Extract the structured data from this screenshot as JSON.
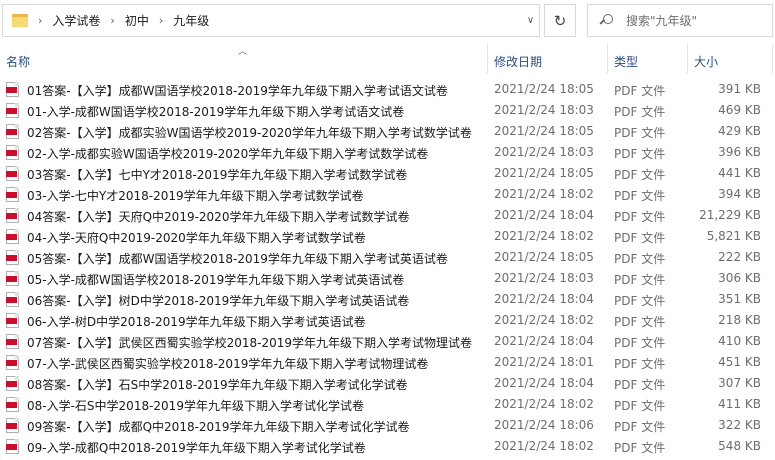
{
  "address_bar": {
    "breadcrumbs": [
      "入学试卷",
      "初中",
      "九年级"
    ],
    "refresh_icon": "refresh-icon"
  },
  "search": {
    "placeholder": "搜索\"九年级\""
  },
  "columns": {
    "name": "名称",
    "date": "修改日期",
    "type": "类型",
    "size": "大小"
  },
  "files": [
    {
      "name": "01答案-【入学】成都W国语学校2018-2019学年九年级下期入学考试语文试卷",
      "date": "2021/2/24 18:05",
      "type": "PDF 文件",
      "size": "391 KB"
    },
    {
      "name": "01-入学-成都W国语学校2018-2019学年九年级下期入学考试语文试卷",
      "date": "2021/2/24 18:03",
      "type": "PDF 文件",
      "size": "469 KB"
    },
    {
      "name": "02答案-【入学】成都实验W国语学校2019-2020学年九年级下期入学考试数学试卷",
      "date": "2021/2/24 18:05",
      "type": "PDF 文件",
      "size": "429 KB"
    },
    {
      "name": "02-入学-成都实验W国语学校2019-2020学年九年级下期入学考试数学试卷",
      "date": "2021/2/24 18:03",
      "type": "PDF 文件",
      "size": "396 KB"
    },
    {
      "name": "03答案-【入学】七中Y才2018-2019学年九年级下期入学考试数学试卷",
      "date": "2021/2/24 18:05",
      "type": "PDF 文件",
      "size": "441 KB"
    },
    {
      "name": "03-入学-七中Y才2018-2019学年九年级下期入学考试数学试卷",
      "date": "2021/2/24 18:02",
      "type": "PDF 文件",
      "size": "394 KB"
    },
    {
      "name": "04答案-【入学】天府Q中2019-2020学年九年级下期入学考试数学试卷",
      "date": "2021/2/24 18:04",
      "type": "PDF 文件",
      "size": "21,229 KB"
    },
    {
      "name": "04-入学-天府Q中2019-2020学年九年级下期入学考试数学试卷",
      "date": "2021/2/24 18:02",
      "type": "PDF 文件",
      "size": "5,821 KB"
    },
    {
      "name": "05答案-【入学】成都W国语学校2018-2019学年九年级下期入学考试英语试卷",
      "date": "2021/2/24 18:05",
      "type": "PDF 文件",
      "size": "222 KB"
    },
    {
      "name": "05-入学-成都W国语学校2018-2019学年九年级下期入学考试英语试卷",
      "date": "2021/2/24 18:03",
      "type": "PDF 文件",
      "size": "306 KB"
    },
    {
      "name": "06答案-【入学】树D中学2018-2019学年九年级下期入学考试英语试卷",
      "date": "2021/2/24 18:04",
      "type": "PDF 文件",
      "size": "351 KB"
    },
    {
      "name": "06-入学-树D中学2018-2019学年九年级下期入学考试英语试卷",
      "date": "2021/2/24 18:02",
      "type": "PDF 文件",
      "size": "218 KB"
    },
    {
      "name": "07答案-【入学】武侯区西蜀实验学校2018-2019学年九年级下期入学考试物理试卷",
      "date": "2021/2/24 18:04",
      "type": "PDF 文件",
      "size": "410 KB"
    },
    {
      "name": "07-入学-武侯区西蜀实验学校2018-2019学年九年级下期入学考试物理试卷",
      "date": "2021/2/24 18:01",
      "type": "PDF 文件",
      "size": "451 KB"
    },
    {
      "name": "08答案-【入学】石S中学2018-2019学年九年级下期入学考试化学试卷",
      "date": "2021/2/24 18:04",
      "type": "PDF 文件",
      "size": "307 KB"
    },
    {
      "name": "08-入学-石S中学2018-2019学年九年级下期入学考试化学试卷",
      "date": "2021/2/24 18:02",
      "type": "PDF 文件",
      "size": "411 KB"
    },
    {
      "name": "09答案-【入学】成都Q中2018-2019学年九年级下期入学考试化学试卷",
      "date": "2021/2/24 18:06",
      "type": "PDF 文件",
      "size": "322 KB"
    },
    {
      "name": "09-入学-成都Q中2018-2019学年九年级下期入学考试化学试卷",
      "date": "2021/2/24 18:02",
      "type": "PDF 文件",
      "size": "548 KB"
    }
  ]
}
